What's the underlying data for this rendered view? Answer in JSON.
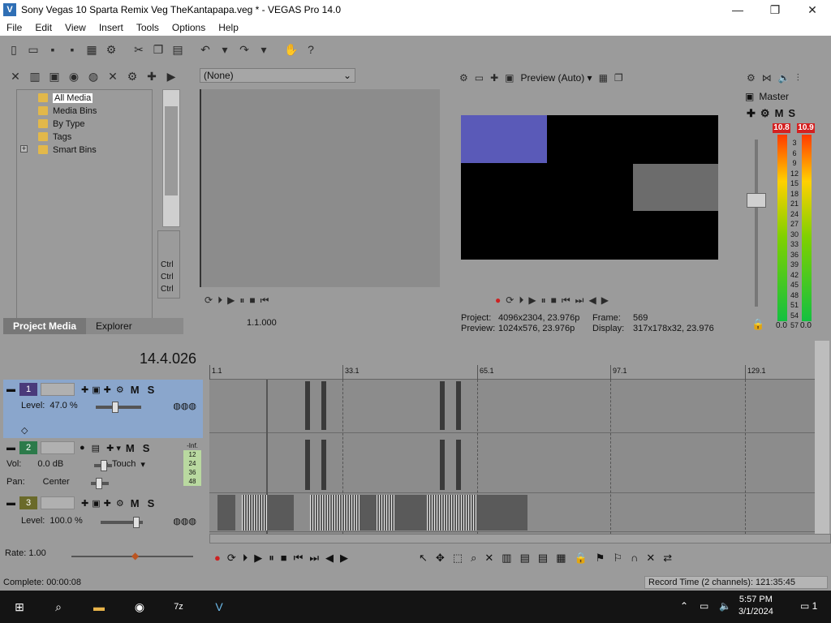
{
  "window": {
    "title": "Sony Vegas 10 Sparta Remix Veg TheKantapapa.veg * - VEGAS Pro 14.0",
    "app_icon": "vegas-logo-icon",
    "min": "—",
    "max": "❐",
    "close": "✕"
  },
  "menu": [
    "File",
    "Edit",
    "View",
    "Insert",
    "Tools",
    "Options",
    "Help"
  ],
  "project_media": {
    "tree": [
      "All Media",
      "Media Bins",
      "By Type",
      "Tags",
      "Smart Bins"
    ],
    "selected": "All Media",
    "expander": "+",
    "ctrl_labels": [
      "Ctrl",
      "Ctrl",
      "Ctrl"
    ],
    "tabs": [
      "Project Media",
      "Explorer"
    ],
    "active_tab": "Project Media"
  },
  "trimmer": {
    "selector_value": "(None)",
    "time": "1.1.000"
  },
  "preview": {
    "quality": "Preview (Auto)",
    "project_label": "Project:",
    "project_value": "4096x2304, 23.976p",
    "preview_label": "Preview:",
    "preview_value": "1024x576, 23.976p",
    "frame_label": "Frame:",
    "frame_value": "569",
    "display_label": "Display:",
    "display_value": "317x178x32, 23.976"
  },
  "master": {
    "title": "Master",
    "m": "M",
    "s": "S",
    "peak_left": "10.8",
    "peak_right": "10.9",
    "scale": [
      "3",
      "6",
      "9",
      "12",
      "15",
      "18",
      "21",
      "24",
      "27",
      "30",
      "33",
      "36",
      "39",
      "42",
      "45",
      "48",
      "51",
      "54",
      "57"
    ],
    "bottom_left": "0.0",
    "bottom_right": "0.0"
  },
  "timeline": {
    "cursor_time": "14.4.026",
    "ruler": [
      "1.1",
      "33.1",
      "65.1",
      "97.1",
      "129.1"
    ],
    "tracks": [
      {
        "num": "1",
        "type": "video",
        "level_label": "Level:",
        "level_value": "47.0 %",
        "m": "M",
        "s": "S"
      },
      {
        "num": "2",
        "type": "audio",
        "vol_label": "Vol:",
        "vol_value": "0.0 dB",
        "pan_label": "Pan:",
        "pan_value": "Center",
        "mode": "Touch",
        "m": "M",
        "s": "S",
        "meter_labels": [
          "-Inf.",
          "12",
          "24",
          "36",
          "48"
        ]
      },
      {
        "num": "3",
        "type": "video",
        "level_label": "Level:",
        "level_value": "100.0 %",
        "m": "M",
        "s": "S"
      }
    ]
  },
  "bottom": {
    "rate": "Rate: 1.00",
    "complete": "Complete: 00:00:08",
    "record_time": "Record Time (2 channels): 121:35:45"
  },
  "taskbar": {
    "time": "5:57 PM",
    "date": "3/1/2024",
    "notifications": "1"
  }
}
